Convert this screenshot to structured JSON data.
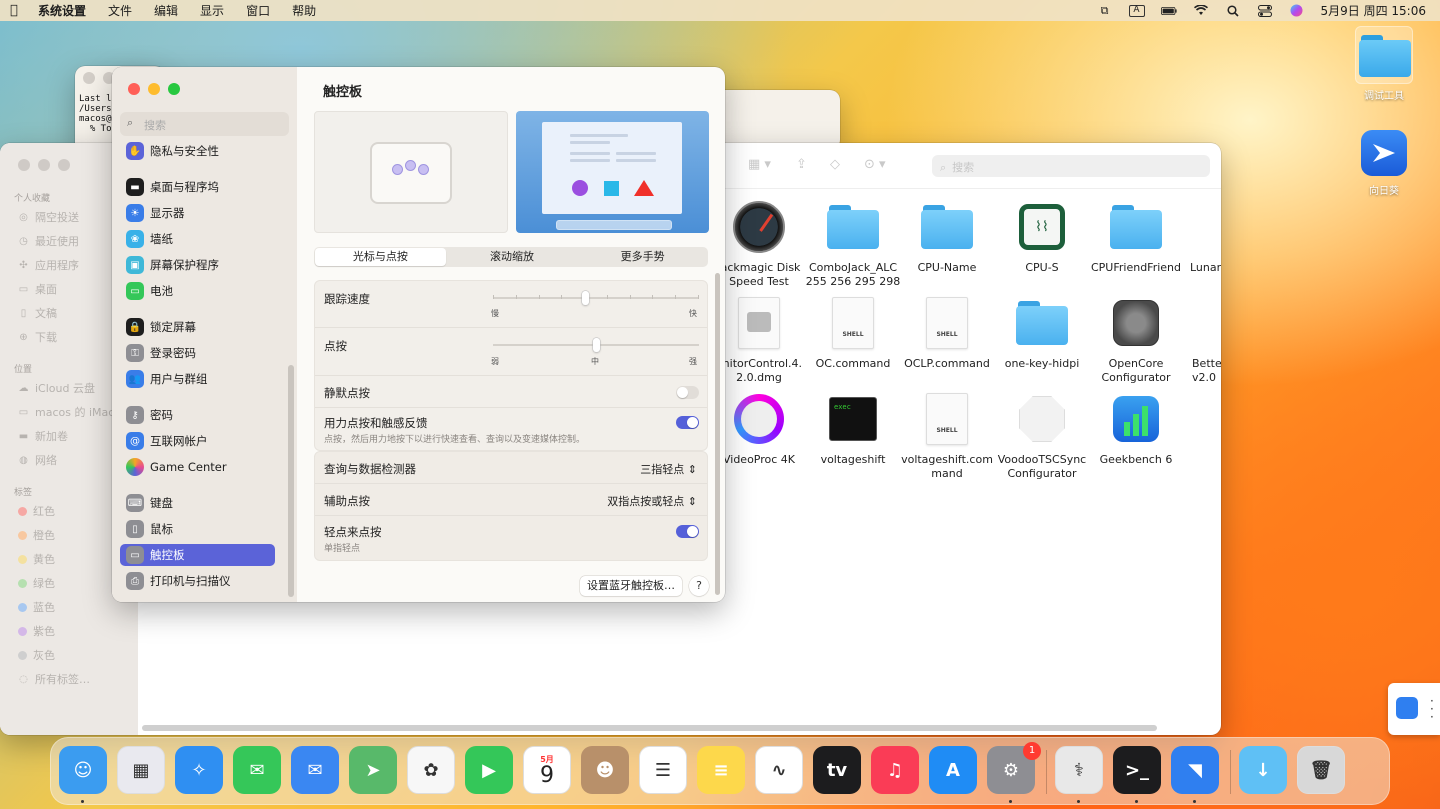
{
  "menubar": {
    "app": "系统设置",
    "items": [
      "文件",
      "编辑",
      "显示",
      "窗口",
      "帮助"
    ],
    "input_indicator": "A",
    "datetime": "5月9日 周四 15:06"
  },
  "desktop": {
    "icons": [
      {
        "label": "调试工具",
        "icon": "folder-icon"
      },
      {
        "label": "向日葵",
        "icon": "sunlogin-icon"
      }
    ]
  },
  "terminal": {
    "lines": [
      "Last l",
      "/Users",
      "macos@",
      "  % To"
    ]
  },
  "finder": {
    "sidebar": {
      "favorites_header": "个人收藏",
      "favorites": [
        "隔空投送",
        "最近使用",
        "应用程序",
        "桌面",
        "文稿",
        "下载"
      ],
      "locations_header": "位置",
      "locations": [
        "iCloud 云盘",
        "macos 的 iMac",
        "新加卷",
        "网络"
      ],
      "tags_header": "标签",
      "tags": [
        {
          "name": "红色",
          "color": "#f6a8a4"
        },
        {
          "name": "橙色",
          "color": "#f8c8a0"
        },
        {
          "name": "黄色",
          "color": "#f4e1a0"
        },
        {
          "name": "绿色",
          "color": "#b6e0b0"
        },
        {
          "name": "蓝色",
          "color": "#a8c8f0"
        },
        {
          "name": "紫色",
          "color": "#d4b8e8"
        },
        {
          "name": "灰色",
          "color": "#cfcfcf"
        }
      ],
      "all_tags": "所有标签…"
    },
    "search_placeholder": "搜索",
    "items": [
      {
        "label": "lackmagic Disk Speed Test",
        "kind": "app-gauge"
      },
      {
        "label": "ComboJack_ALC 255 256 295 298",
        "kind": "folder"
      },
      {
        "label": "CPU-Name",
        "kind": "folder"
      },
      {
        "label": "CPU-S",
        "kind": "app-cpus"
      },
      {
        "label": "CPUFriendFriend",
        "kind": "folder"
      },
      {
        "label": "Lunar-",
        "kind": "partial"
      },
      {
        "label": "onitorControl.4. 2.0.dmg",
        "kind": "dmg"
      },
      {
        "label": "OC.command",
        "kind": "shell"
      },
      {
        "label": "OCLP.command",
        "kind": "shell"
      },
      {
        "label": "one-key-hidpi",
        "kind": "folder"
      },
      {
        "label": "OpenCore Configurator",
        "kind": "app-opencore"
      },
      {
        "label": "Bette v2.0",
        "kind": "partial"
      },
      {
        "label": "VideoProc 4K",
        "kind": "app-videoproc"
      },
      {
        "label": "voltageshift",
        "kind": "exec"
      },
      {
        "label": "voltageshift.com mand",
        "kind": "shell"
      },
      {
        "label": "VoodooTSCSync Configurator",
        "kind": "app-voodoo"
      },
      {
        "label": "Geekbench 6",
        "kind": "app-geekbench"
      }
    ],
    "shell_label": "SHELL",
    "exec_label": "exec"
  },
  "settings": {
    "search_placeholder": "搜索",
    "sidebar": [
      {
        "label": "隐私与安全性",
        "icon": "hand-icon",
        "color": "#5b63d8"
      },
      {
        "label": "桌面与程序坞",
        "icon": "dock-icon",
        "color": "#1e1e1e"
      },
      {
        "label": "显示器",
        "icon": "sun-icon",
        "color": "#3a7de8"
      },
      {
        "label": "墙纸",
        "icon": "flower-icon",
        "color": "#39b1e8"
      },
      {
        "label": "屏幕保护程序",
        "icon": "screensaver-icon",
        "color": "#3fb8d8"
      },
      {
        "label": "电池",
        "icon": "battery-icon",
        "color": "#34c759"
      },
      {
        "label": "锁定屏幕",
        "icon": "lock-icon",
        "color": "#1e1e1e"
      },
      {
        "label": "登录密码",
        "icon": "padlock-icon",
        "color": "#8e8e93"
      },
      {
        "label": "用户与群组",
        "icon": "users-icon",
        "color": "#3a7de8"
      },
      {
        "label": "密码",
        "icon": "key-icon",
        "color": "#8e8e93"
      },
      {
        "label": "互联网帐户",
        "icon": "at-icon",
        "color": "#3a7de8"
      },
      {
        "label": "Game Center",
        "icon": "gamecenter-icon",
        "color": "#e84a8f"
      },
      {
        "label": "键盘",
        "icon": "keyboard-icon",
        "color": "#8e8e93"
      },
      {
        "label": "鼠标",
        "icon": "mouse-icon",
        "color": "#8e8e93"
      },
      {
        "label": "触控板",
        "icon": "trackpad-icon",
        "color": "#8e8e93"
      },
      {
        "label": "打印机与扫描仪",
        "icon": "printer-icon",
        "color": "#8e8e93"
      }
    ],
    "title": "触控板",
    "tabs": [
      "光标与点按",
      "滚动缩放",
      "更多手势"
    ],
    "active_tab": 0,
    "tracking_speed": {
      "label": "跟踪速度",
      "min_label": "慢",
      "max_label": "快",
      "value": 0.45
    },
    "click": {
      "label": "点按",
      "min_label": "弱",
      "mid_label": "中",
      "max_label": "强",
      "value": 0.5
    },
    "silent_click": {
      "label": "静默点按",
      "on": false
    },
    "force_click": {
      "label": "用力点按和触感反馈",
      "desc": "点按，然后用力地按下以进行快速查看、查询以及变速媒体控制。",
      "on": true
    },
    "lookup": {
      "label": "查询与数据检测器",
      "value": "三指轻点"
    },
    "secondary_click": {
      "label": "辅助点按",
      "value": "双指点按或轻点"
    },
    "tap_to_click": {
      "label": "轻点来点按",
      "desc": "单指轻点",
      "on": true
    },
    "bluetooth_button": "设置蓝牙触控板…",
    "help": "?"
  },
  "dock": {
    "apps": [
      {
        "name": "finder",
        "color": "#3b9cf0",
        "glyph": "☺",
        "running": true
      },
      {
        "name": "launchpad",
        "color": "#e9e9ef",
        "glyph": "▦",
        "running": false
      },
      {
        "name": "safari",
        "color": "#2f8ff2",
        "glyph": "✧",
        "running": false
      },
      {
        "name": "messages",
        "color": "#35c759",
        "glyph": "✉",
        "running": false
      },
      {
        "name": "mail",
        "color": "#3a87f2",
        "glyph": "✉",
        "running": false
      },
      {
        "name": "maps",
        "color": "#58b96a",
        "glyph": "➤",
        "running": false
      },
      {
        "name": "photos",
        "color": "#f7f7f7",
        "glyph": "✿",
        "running": false
      },
      {
        "name": "facetime",
        "color": "#34c759",
        "glyph": "▶",
        "running": false
      },
      {
        "name": "calendar",
        "color": "#ffffff",
        "glyph": "9",
        "running": false
      },
      {
        "name": "contacts",
        "color": "#b8906a",
        "glyph": "☻",
        "running": false
      },
      {
        "name": "reminders",
        "color": "#ffffff",
        "glyph": "☰",
        "running": false
      },
      {
        "name": "notes",
        "color": "#fdd84b",
        "glyph": "≡",
        "running": false
      },
      {
        "name": "freeform",
        "color": "#ffffff",
        "glyph": "∿",
        "running": false
      },
      {
        "name": "tv",
        "color": "#1c1c1e",
        "glyph": "tv",
        "running": false
      },
      {
        "name": "music",
        "color": "#fa3c56",
        "glyph": "♫",
        "running": false
      },
      {
        "name": "app-store",
        "color": "#1f8cf5",
        "glyph": "A",
        "running": false
      },
      {
        "name": "system-settings",
        "color": "#8e8e93",
        "glyph": "⚙",
        "running": true,
        "badge": "1"
      },
      {
        "name": "disk-utility",
        "color": "#e8e8e8",
        "glyph": "⚕",
        "running": true
      },
      {
        "name": "terminal",
        "color": "#1c1c1e",
        "glyph": ">_",
        "running": true
      },
      {
        "name": "sunlogin",
        "color": "#2f7ff0",
        "glyph": "◥",
        "running": true
      },
      {
        "name": "downloads",
        "color": "#5fc0f5",
        "glyph": "↓",
        "running": false
      },
      {
        "name": "trash",
        "color": "#d8d8d8",
        "glyph": "🗑",
        "running": false
      }
    ],
    "calendar_month": "5月",
    "calendar_day": "9"
  }
}
